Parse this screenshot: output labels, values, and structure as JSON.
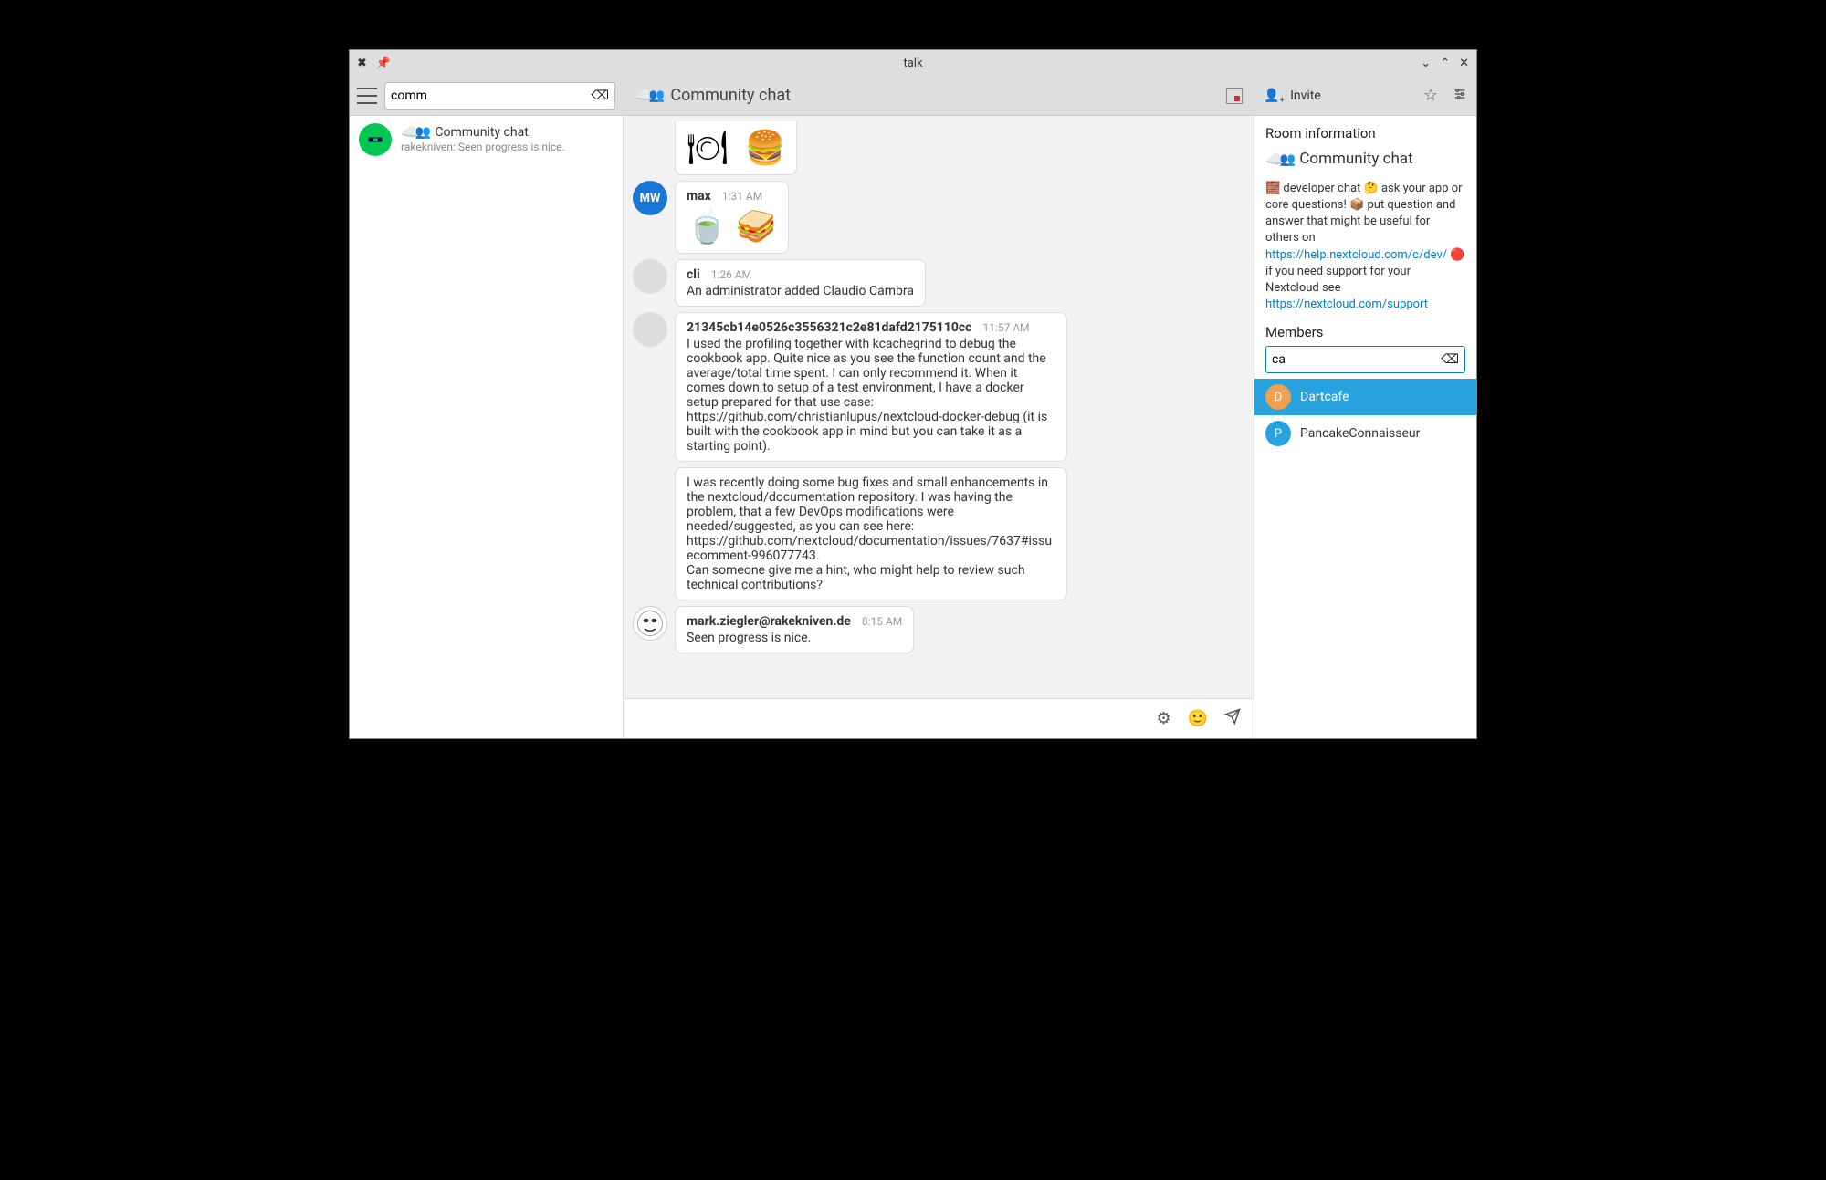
{
  "window": {
    "title": "talk"
  },
  "sidebar": {
    "search_value": "comm",
    "conversations": [
      {
        "icon": "☁️👥",
        "title": "Community chat",
        "subtitle": "rakekniven: Seen progress is nice."
      }
    ]
  },
  "chat": {
    "icon": "☁️👥",
    "title": "Community chat",
    "messages": [
      {
        "type": "partial_emoji",
        "emojis": "🍽️🍔"
      },
      {
        "avatar_text": "MW",
        "avatar_class": "blue",
        "author": "max",
        "time": "1:31 AM",
        "body_type": "emoji",
        "emojis": "🍵🥪"
      },
      {
        "avatar_text": "",
        "avatar_class": "",
        "author": "cli",
        "time": "1:26 AM",
        "body_type": "text",
        "body": "An administrator added Claudio Cambra"
      },
      {
        "avatar_text": "",
        "avatar_class": "",
        "author": "21345cb14e0526c3556321c2e81dafd2175110cc",
        "time": "11:57 AM",
        "body_type": "text",
        "body": "I used the profiling together with kcachegrind to debug the cookbook app. Quite nice as you see the function count and the average/total time spent. I can only recommend it. When it comes down to setup of a test environment, I have a docker setup prepared for that use case: https://github.com/christianlupus/nextcloud-docker-debug (it is built with the cookbook app in mind but you can take it as a starting point)."
      },
      {
        "continuation": true,
        "body_type": "text",
        "body": "I was recently doing some bug fixes and small enhancements in the nextcloud/documentation repository. I was having the problem, that a few DevOps modifications were needed/suggested, as you can see here: https://github.com/nextcloud/documentation/issues/7637#issuecomment-996077743.\nCan someone give me a hint, who might help to review such technical contributions?"
      },
      {
        "avatar_text": "",
        "avatar_class": "face",
        "author": "mark.ziegler@rakekniven.de",
        "time": "8:15 AM",
        "body_type": "text",
        "body": "Seen progress is nice."
      }
    ]
  },
  "rightpanel": {
    "invite_label": "Invite",
    "info_heading": "Room information",
    "room_icon": "☁️👥",
    "room_name": "Community chat",
    "description_parts": [
      {
        "t": "text",
        "v": "🧱 developer chat 🤔 ask your app or core questions! 📦 put question and answer that might be useful for others on "
      },
      {
        "t": "link",
        "v": "https://help.nextcloud.com/c/dev/"
      },
      {
        "t": "text",
        "v": " 🔴 if you need support for your Nextcloud see "
      },
      {
        "t": "link",
        "v": "https://nextcloud.com/support"
      }
    ],
    "members_heading": "Members",
    "member_search_value": "ca",
    "members": [
      {
        "initial": "D",
        "name": "Dartcafe",
        "color": "d",
        "selected": true
      },
      {
        "initial": "P",
        "name": "PancakeConnaisseur",
        "color": "p",
        "selected": false
      }
    ]
  }
}
